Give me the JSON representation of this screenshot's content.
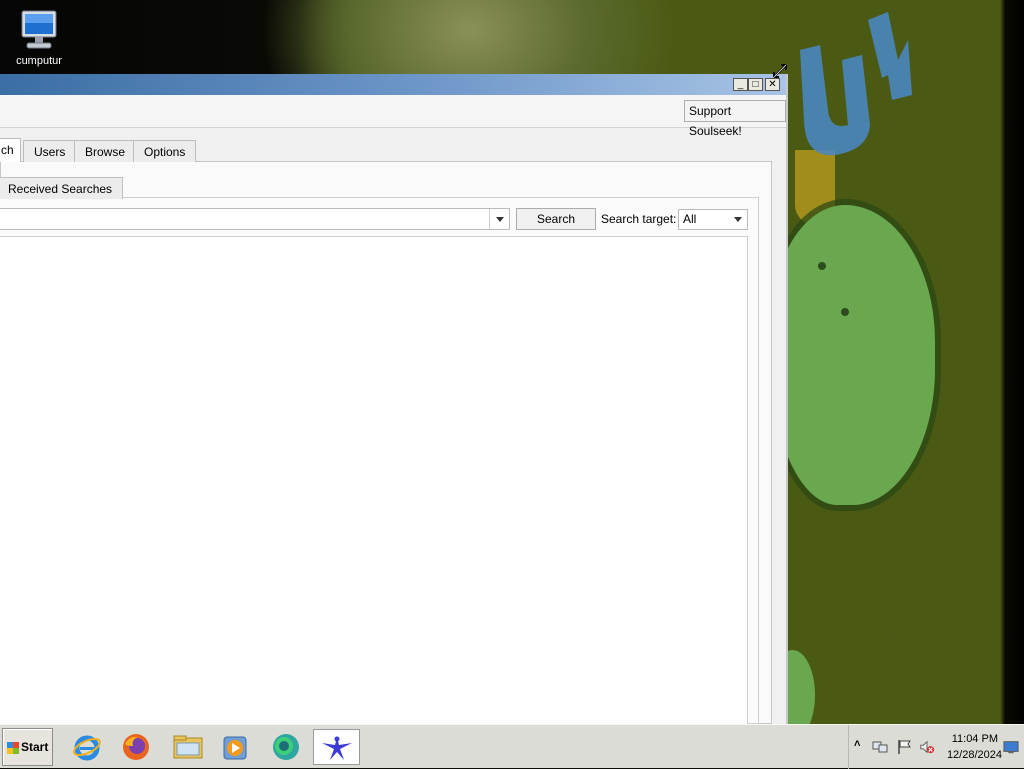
{
  "desktop": {
    "icon_label": "cumputur"
  },
  "window": {
    "support_button": "Support Soulseek!",
    "tabs": [
      {
        "label": "ch"
      },
      {
        "label": "Users"
      },
      {
        "label": "Browse"
      },
      {
        "label": "Options"
      }
    ],
    "subtab": "Received Searches",
    "search": {
      "value": "",
      "button_label": "Search",
      "target_label": "Search target:",
      "target_value": "All"
    }
  },
  "taskbar": {
    "start_label": "Start",
    "apps": [
      "internet-explorer-icon",
      "firefox-icon",
      "file-explorer-icon",
      "media-player-icon",
      "chat-app-icon",
      "soulseek-icon"
    ],
    "clock_time": "11:04 PM",
    "clock_date": "12/28/2024"
  },
  "colors": {
    "title_bar": "#3a6ea5",
    "window_bg": "#f0f0f0",
    "taskbar_bg": "#dcdcd6",
    "wallpaper_green": "#6aa84f"
  }
}
